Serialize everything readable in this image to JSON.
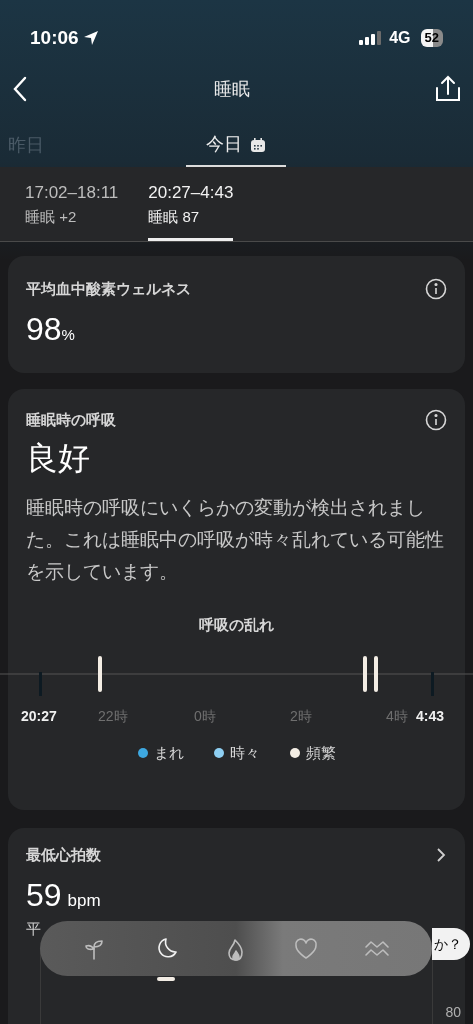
{
  "status_bar": {
    "time": "10:06",
    "network": "4G",
    "battery": "52"
  },
  "header": {
    "title": "睡眠"
  },
  "day_tabs": [
    {
      "label": "昨日",
      "selected": false
    },
    {
      "label": "今日",
      "selected": true
    }
  ],
  "sessions": [
    {
      "time": "17:02–18:11",
      "label": "睡眠 +2",
      "selected": false
    },
    {
      "time": "20:27–4:43",
      "label": "睡眠 87",
      "selected": true
    }
  ],
  "oxygen_card": {
    "title": "平均血中酸素ウェルネス",
    "value": "98",
    "unit": "%"
  },
  "breathing_card": {
    "title": "睡眠時の呼吸",
    "value": "良好",
    "description": "睡眠時の呼吸にいくらかの変動が検出されました。これは睡眠中の呼吸が時々乱れている可能性を示しています。",
    "chart_title": "呼吸の乱れ",
    "start": "20:27",
    "end": "4:43",
    "ticks": [
      "22時",
      "0時",
      "2時",
      "4時"
    ],
    "legend": [
      {
        "label": "まれ",
        "color": "#3ea8e0"
      },
      {
        "label": "時々",
        "color": "#8ecff2"
      },
      {
        "label": "頻繁",
        "color": "#f3ede4"
      }
    ]
  },
  "heart_card": {
    "title": "最低心拍数",
    "value": "59",
    "unit": "bpm",
    "subtitle": "平",
    "axis_label": "80"
  },
  "help_pill": "か？",
  "bottom_nav": [
    {
      "kind": "sprout",
      "selected": false
    },
    {
      "kind": "moon",
      "selected": true
    },
    {
      "kind": "flame",
      "selected": false
    },
    {
      "kind": "heart",
      "selected": false
    },
    {
      "kind": "waves",
      "selected": false
    }
  ]
}
